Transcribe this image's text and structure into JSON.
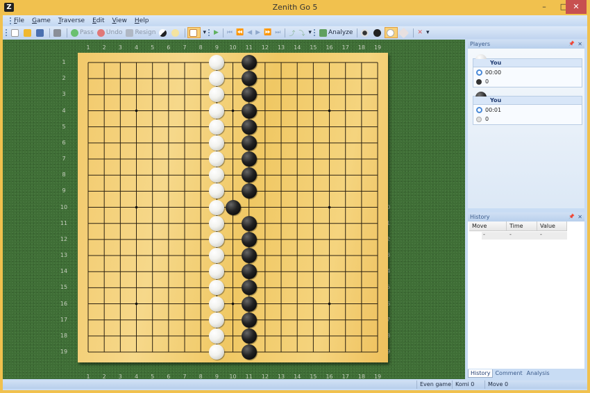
{
  "window": {
    "title": "Zenith Go 5",
    "minimize": "–",
    "maximize": "□",
    "close": "✕"
  },
  "menu": [
    "File",
    "Game",
    "Traverse",
    "Edit",
    "View",
    "Help"
  ],
  "toolbar": {
    "pass": "Pass",
    "undo": "Undo",
    "resign": "Resign",
    "analyze": "Analyze"
  },
  "board": {
    "size": 19,
    "col_labels": [
      "1",
      "2",
      "3",
      "4",
      "5",
      "6",
      "7",
      "8",
      "9",
      "10",
      "11",
      "12",
      "13",
      "14",
      "15",
      "16",
      "17",
      "18",
      "19"
    ],
    "row_labels": [
      "1",
      "2",
      "3",
      "4",
      "5",
      "6",
      "7",
      "8",
      "9",
      "10",
      "11",
      "12",
      "13",
      "14",
      "15",
      "16",
      "17",
      "18",
      "19"
    ],
    "hoshi": [
      [
        4,
        4
      ],
      [
        10,
        4
      ],
      [
        16,
        4
      ],
      [
        4,
        10
      ],
      [
        10,
        10
      ],
      [
        16,
        10
      ],
      [
        4,
        16
      ],
      [
        10,
        16
      ],
      [
        16,
        16
      ]
    ],
    "white_stones": [
      [
        9,
        1
      ],
      [
        9,
        2
      ],
      [
        9,
        3
      ],
      [
        9,
        4
      ],
      [
        9,
        5
      ],
      [
        9,
        6
      ],
      [
        9,
        7
      ],
      [
        9,
        8
      ],
      [
        9,
        9
      ],
      [
        9,
        10
      ],
      [
        9,
        11
      ],
      [
        9,
        12
      ],
      [
        9,
        13
      ],
      [
        9,
        14
      ],
      [
        9,
        15
      ],
      [
        9,
        16
      ],
      [
        9,
        17
      ],
      [
        9,
        18
      ],
      [
        9,
        19
      ]
    ],
    "black_stones": [
      [
        11,
        1
      ],
      [
        11,
        2
      ],
      [
        11,
        3
      ],
      [
        11,
        4
      ],
      [
        11,
        5
      ],
      [
        11,
        6
      ],
      [
        11,
        7
      ],
      [
        11,
        8
      ],
      [
        11,
        9
      ],
      [
        10,
        10
      ],
      [
        11,
        11
      ],
      [
        11,
        12
      ],
      [
        11,
        13
      ],
      [
        11,
        14
      ],
      [
        11,
        15
      ],
      [
        11,
        16
      ],
      [
        11,
        17
      ],
      [
        11,
        18
      ],
      [
        11,
        19
      ]
    ]
  },
  "players_panel": {
    "title": "Players",
    "white": {
      "name": "You",
      "time": "00:00",
      "captures": "0"
    },
    "black": {
      "name": "You",
      "time": "00:01",
      "captures": "0"
    }
  },
  "history_panel": {
    "title": "History",
    "columns": [
      "Move",
      "Time",
      "Value"
    ],
    "rows": [
      [
        "-",
        "-",
        "-"
      ]
    ]
  },
  "bottom_tabs": [
    "History",
    "Comment",
    "Analysis"
  ],
  "status": {
    "game": "Even game",
    "komi": "Komi 0",
    "move": "Move 0"
  },
  "colors": {
    "felt": "#3f6e36",
    "board": "#f4d07a",
    "chrome": "#c8dcf4",
    "frame": "#f1c14e"
  }
}
